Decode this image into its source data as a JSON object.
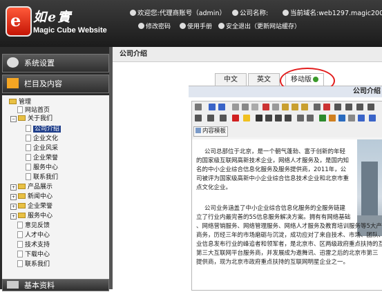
{
  "header": {
    "logo_mark": "e",
    "logo_cn": "如e實",
    "logo_en": "Magic Cube Website",
    "welcome_label": "欢迎您:",
    "welcome_value": "代理商账号（admin）",
    "company_label": "公司名称:",
    "domain_label": "当前域名:",
    "domain_value": "web1297.magic200",
    "links": {
      "change_password": "修改密码",
      "manual": "使用手册",
      "logout": "安全退出（更新网站缓存）"
    }
  },
  "sidebar": {
    "sections": {
      "system": "系统设置",
      "columns": "栏目及内容",
      "basic": "基本资料"
    },
    "tree": {
      "root": "管理",
      "home": "网站首页",
      "about": "关于我们",
      "about_children": [
        "公司介绍",
        "企业文化",
        "企业风采",
        "企业荣誉",
        "服务中心",
        "联系我们"
      ],
      "others": [
        "产品展示",
        "新闻中心",
        "企业荣誉",
        "服务中心",
        "意见反馈",
        "人才中心",
        "技术支持",
        "下载中心",
        "联系我们"
      ]
    }
  },
  "main": {
    "title": "公司介绍",
    "tabs": [
      "中文",
      "英文",
      "移动版"
    ],
    "content_title": "公司介绍",
    "template_button": "内容模板",
    "paragraphs": {
      "p1": [
        "公司总部位于北京，是一个朝气蓬勃、富于创新的年轻",
        "的国家级互联网高新技术企业，网络人才服务及，是国内知",
        "名的中小企业综合信息化服务及服务提供商，2011年，公",
        "司被评为国家级高新中小企业综合信息技术企业和北京市重",
        "点文化企业。"
      ],
      "p2": [
        "公司业务涵盖了中小企业综合信息化服务的全服务链建",
        "立了行业内最完善的5S信息服务解决方案。拥有有网络基础",
        "、网络营销服务、网络管理服务、网络人才服务及教育培训服务等5大产",
        "商务，历经三年的市场磨砺与沉淀，成功应对了来自技术、市场、团队、",
        "业信息发布行业的峰追者和领军者，是北京市、区两级政府重点扶持的互",
        "第三大互联网平台服务商，并发展成为邀舞讯、迅雷之后的北京市第三",
        "提供商，现为北京市政府重点扶持的互联网明星企业之一。"
      ]
    }
  },
  "colors": {
    "active_node": "#1f3e8a",
    "tab_highlight": "#e21b1b",
    "logo_red": "#c41505",
    "header_bg": "#1b1b1b"
  }
}
